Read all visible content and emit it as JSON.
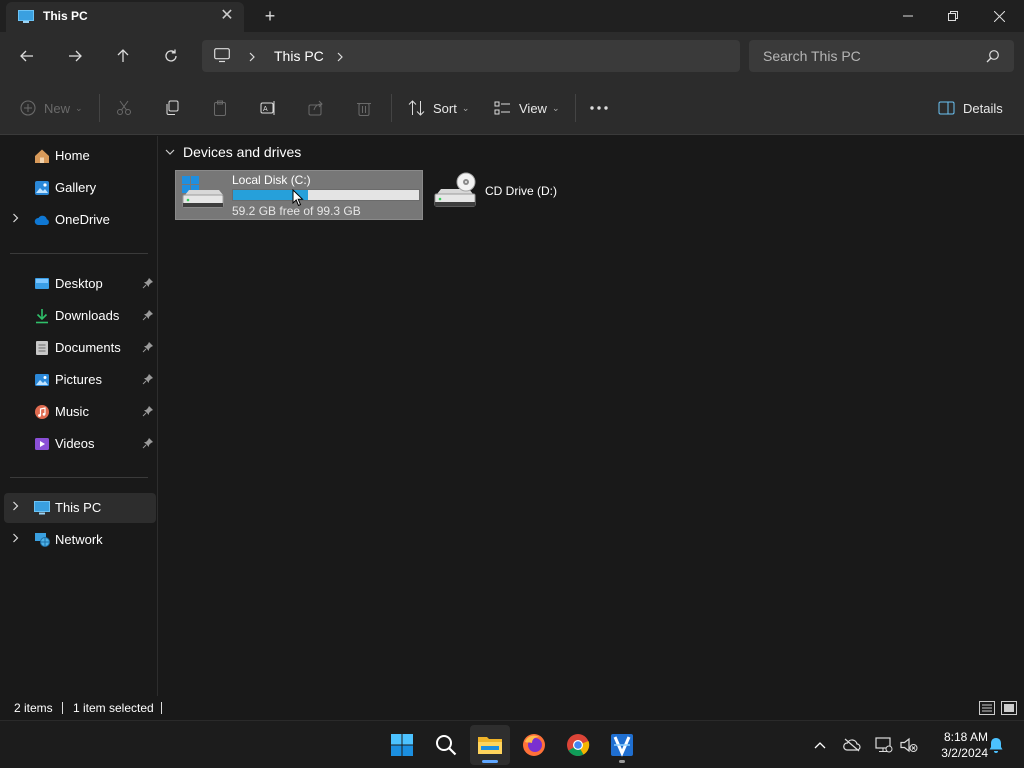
{
  "window": {
    "tab_title": "This PC",
    "tab_icon": "monitor-icon",
    "new_tab_icon": "plus-icon"
  },
  "address": {
    "location": "This PC",
    "search_placeholder": "Search This PC"
  },
  "toolbar": {
    "new_label": "New",
    "sort_label": "Sort",
    "view_label": "View",
    "details_label": "Details"
  },
  "sidebar": {
    "items": [
      {
        "label": "Home",
        "icon": "home-icon"
      },
      {
        "label": "Gallery",
        "icon": "gallery-icon"
      },
      {
        "label": "OneDrive",
        "icon": "cloud-icon"
      },
      {
        "label": "Desktop",
        "icon": "desktop-folder-icon",
        "pinned": true
      },
      {
        "label": "Downloads",
        "icon": "download-icon",
        "pinned": true
      },
      {
        "label": "Documents",
        "icon": "document-icon",
        "pinned": true
      },
      {
        "label": "Pictures",
        "icon": "pictures-icon",
        "pinned": true
      },
      {
        "label": "Music",
        "icon": "music-icon",
        "pinned": true
      },
      {
        "label": "Videos",
        "icon": "videos-icon",
        "pinned": true
      },
      {
        "label": "This PC",
        "icon": "monitor-icon",
        "selected": true
      },
      {
        "label": "Network",
        "icon": "network-icon"
      }
    ]
  },
  "content": {
    "group_title": "Devices and drives",
    "drives": [
      {
        "name": "Local Disk (C:)",
        "free_text": "59.2 GB free of 99.3 GB",
        "used_fraction": 0.404,
        "selected": true
      },
      {
        "name": "CD Drive (D:)"
      }
    ]
  },
  "status": {
    "item_count": "2 items",
    "selection": "1 item selected"
  },
  "taskbar": {
    "time": "8:18 AM",
    "date": "3/2/2024",
    "apps": [
      "start-icon",
      "search-icon",
      "file-explorer-icon",
      "firefox-icon",
      "chrome-icon",
      "app-icon"
    ]
  },
  "colors": {
    "accent": "#26a0da",
    "selection_bg": "#777777",
    "chrome_bg": "#2c2c2c",
    "content_bg": "#191919"
  }
}
